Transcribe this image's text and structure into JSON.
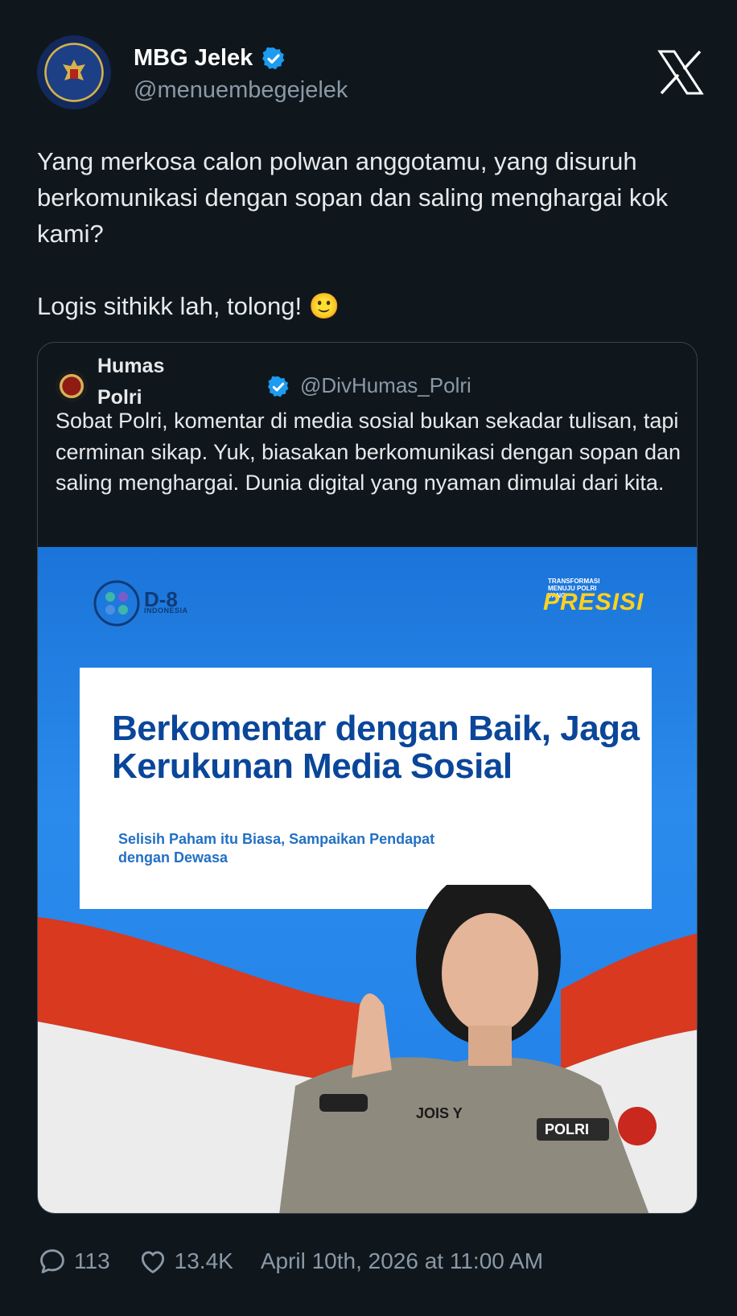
{
  "tweet": {
    "display_name": "MBG Jelek",
    "handle": "@menuembegejelek",
    "text": "Yang merkosa calon polwan anggotamu, yang disuruh berkomunikasi dengan sopan dan saling menghargai kok kami?\n\nLogis sithikk lah, tolong! 🙂"
  },
  "quote": {
    "display_name": "Humas Polri",
    "handle": "@DivHumas_Polri",
    "text": "Sobat Polri, komentar di media sosial bukan sekadar tulisan, tapi cerminan sikap. Yuk, biasakan berkomunikasi dengan sopan dan saling menghargai. Dunia digital yang nyaman dimulai dari kita."
  },
  "poster": {
    "logo_left": "D-8",
    "logo_left_sub": "INDONESIA",
    "logo_right_top": "TRANSFORMASI MENUJU POLRI YANG",
    "logo_right": "PRESISI",
    "headline": "Berkomentar dengan Baik, Jaga Kerukunan Media Sosial",
    "subline": "Selisih Paham itu Biasa, Sampaikan Pendapat dengan Dewasa",
    "name_tag": "JOIS Y",
    "badge": "POLRI"
  },
  "footer": {
    "replies": "113",
    "likes": "13.4K",
    "timestamp": "April 10th, 2026 at 11:00 AM"
  },
  "colors": {
    "background": "#0f171d",
    "verified": "#1d9bf0",
    "secondary_text": "#8b98a5",
    "poster_headline": "#0a4699"
  },
  "icons": [
    "verified-badge-icon",
    "x-logo-icon",
    "reply-icon",
    "like-icon"
  ]
}
